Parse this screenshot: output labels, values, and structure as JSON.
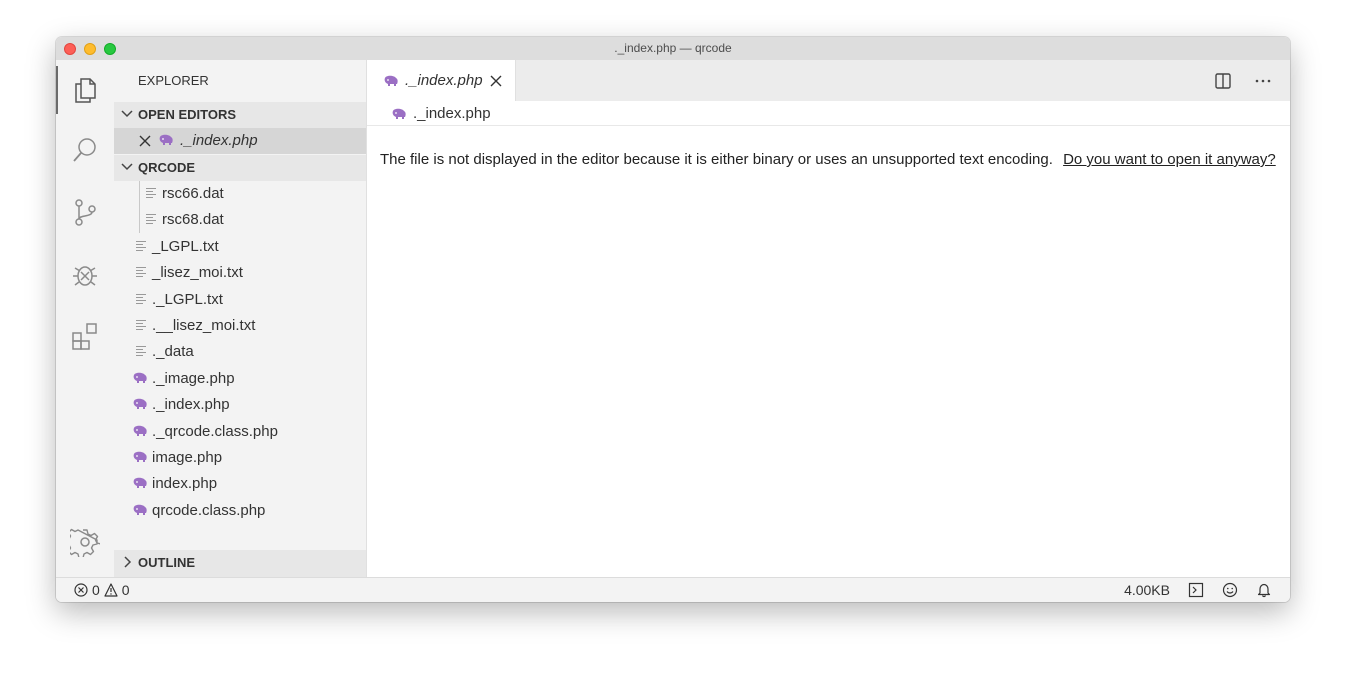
{
  "window": {
    "title": "._index.php — qrcode"
  },
  "explorer": {
    "title": "EXPLORER",
    "open_editors": {
      "header": "OPEN EDITORS",
      "items": [
        {
          "label": "._index.php",
          "icon": "php-elephant-icon"
        }
      ]
    },
    "folder": {
      "header": "QRCODE",
      "items": [
        {
          "label": "rsc66.dat",
          "icon": "text-file-icon"
        },
        {
          "label": "rsc68.dat",
          "icon": "text-file-icon"
        },
        {
          "label": "_LGPL.txt",
          "icon": "text-file-icon"
        },
        {
          "label": "_lisez_moi.txt",
          "icon": "text-file-icon"
        },
        {
          "label": "._LGPL.txt",
          "icon": "text-file-icon"
        },
        {
          "label": ".__lisez_moi.txt",
          "icon": "text-file-icon"
        },
        {
          "label": "._data",
          "icon": "text-file-icon"
        },
        {
          "label": "._image.php",
          "icon": "php-elephant-icon"
        },
        {
          "label": "._index.php",
          "icon": "php-elephant-icon"
        },
        {
          "label": "._qrcode.class.php",
          "icon": "php-elephant-icon"
        },
        {
          "label": "image.php",
          "icon": "php-elephant-icon"
        },
        {
          "label": "index.php",
          "icon": "php-elephant-icon"
        },
        {
          "label": "qrcode.class.php",
          "icon": "php-elephant-icon"
        }
      ]
    },
    "outline": {
      "header": "OUTLINE"
    }
  },
  "editor": {
    "tab": {
      "label": "._index.php"
    },
    "breadcrumb": "._index.php",
    "message": "The file is not displayed in the editor because it is either binary or uses an unsupported text encoding.",
    "message_link": "Do you want to open it anyway?"
  },
  "status": {
    "errors": "0",
    "warnings": "0",
    "file_size": "4.00KB"
  },
  "colors": {
    "php_icon": "#9b6fc4",
    "titlebar": "#dddddd",
    "sidebar": "#f3f3f3"
  }
}
